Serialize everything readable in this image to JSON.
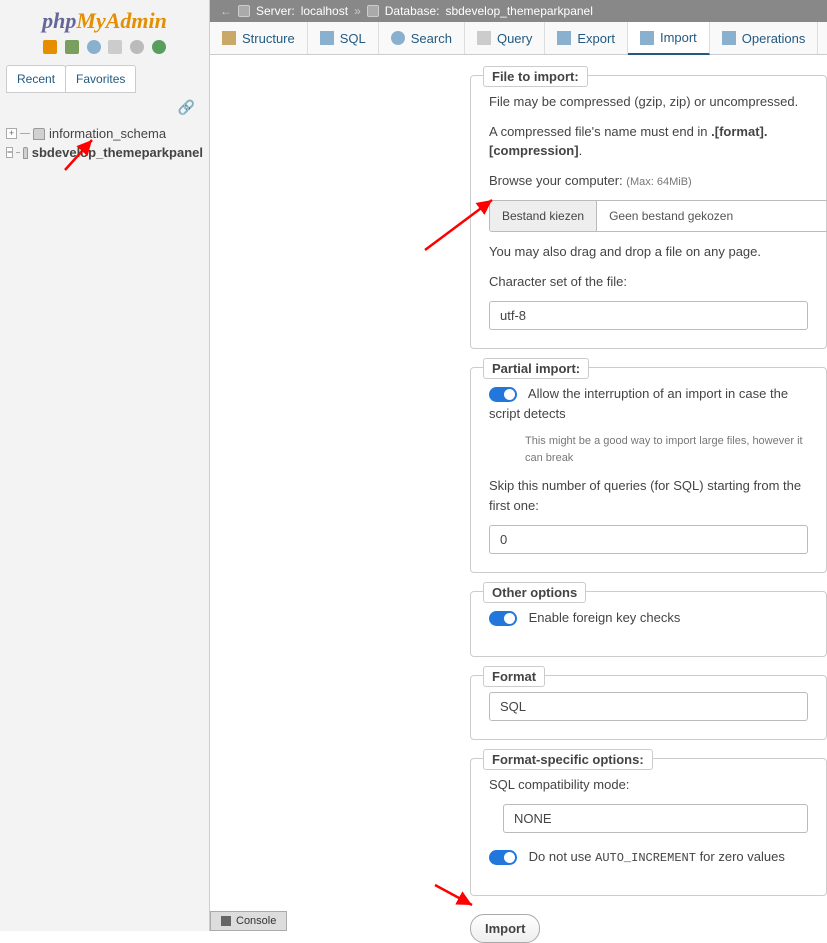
{
  "logo": {
    "part1": "php",
    "part2": "MyAdmin"
  },
  "sidebar": {
    "tabs": [
      "Recent",
      "Favorites"
    ],
    "databases": [
      {
        "name": "information_schema",
        "expanded": false
      },
      {
        "name": "sbdevelop_themeparkpanel",
        "expanded": true
      }
    ]
  },
  "breadcrumb": {
    "server_label": "Server:",
    "server": "localhost",
    "db_label": "Database:",
    "db": "sbdevelop_themeparkpanel"
  },
  "topnav": [
    {
      "label": "Structure",
      "icon": "structure"
    },
    {
      "label": "SQL",
      "icon": "sql"
    },
    {
      "label": "Search",
      "icon": "search"
    },
    {
      "label": "Query",
      "icon": "query"
    },
    {
      "label": "Export",
      "icon": "export"
    },
    {
      "label": "Import",
      "icon": "import",
      "active": true
    },
    {
      "label": "Operations",
      "icon": "operations"
    }
  ],
  "file_import": {
    "legend": "File to import:",
    "line1": "File may be compressed (gzip, zip) or uncompressed.",
    "line2_a": "A compressed file's name must end in ",
    "line2_b": ".[format].[compression]",
    "line2_c": ".",
    "browse": "Browse your computer:",
    "max": "(Max: 64MiB)",
    "choose_btn": "Bestand kiezen",
    "no_file": "Geen bestand gekozen",
    "dragdrop": "You may also drag and drop a file on any page.",
    "charset_label": "Character set of the file:",
    "charset": "utf-8"
  },
  "partial": {
    "legend": "Partial import:",
    "allow": "Allow the interruption of an import in case the script detects",
    "hint": "This might be a good way to import large files, however it can break",
    "skip_label": "Skip this number of queries (for SQL) starting from the first one:",
    "skip_value": "0"
  },
  "other": {
    "legend": "Other options",
    "fk": "Enable foreign key checks"
  },
  "format": {
    "legend": "Format",
    "value": "SQL"
  },
  "specific": {
    "legend": "Format-specific options:",
    "compat_label": "SQL compatibility mode:",
    "compat_value": "NONE",
    "auto_a": "Do not use ",
    "auto_b": "AUTO_INCREMENT",
    "auto_c": " for zero values"
  },
  "submit": "Import",
  "console": "Console"
}
